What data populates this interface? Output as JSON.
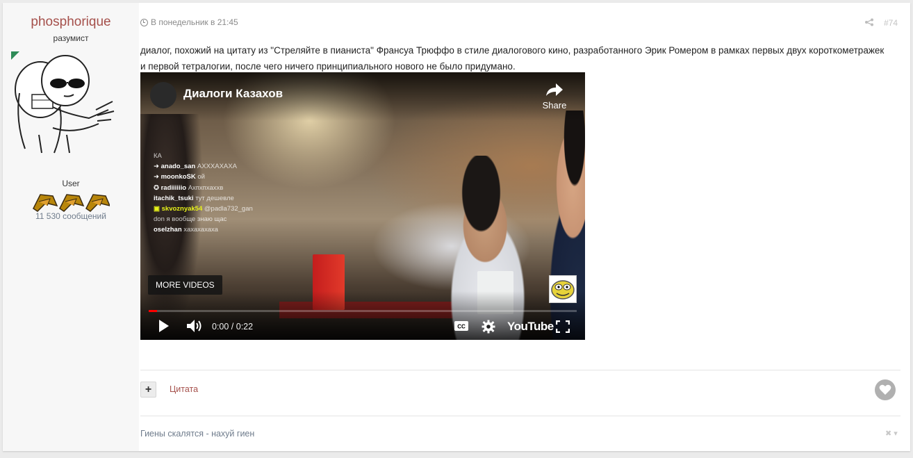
{
  "author": {
    "name": "phosphorique",
    "rank": "разумист",
    "group": "User",
    "posts": "11 530 сообщений"
  },
  "post": {
    "timestamp": "В понедельник в 21:45",
    "number": "#74",
    "text": "диалог, похожий на цитату из \"Стреляйте в пианиста\" Франсуа Трюффо в стиле диалогового кино, разработанного Эрик Ромером в рамках первых двух короткометражек и первой тетралогии, после чего ничего принципиального нового не было придумано."
  },
  "video": {
    "title": "Диалоги Казахов",
    "share_label": "Share",
    "more_videos_label": "MORE VIDEOS",
    "time": "0:00 / 0:22",
    "platform": "YouTube",
    "progress": 0.02,
    "chat": [
      {
        "user": "",
        "message": "КА"
      },
      {
        "user": "anado_san",
        "message": "АХХХАХАХА"
      },
      {
        "user": "moonkoSK",
        "message": "ой"
      },
      {
        "user": "radiiiiiio",
        "message": "Ахпхпхаххв"
      },
      {
        "user": "itachik_tsuki",
        "message": "тут дешевле"
      },
      {
        "user": "skvoznyak54",
        "message": "@padla732_gan"
      },
      {
        "user": "",
        "message": "don я вообще знаю щас"
      },
      {
        "user": "oselzhan",
        "message": "хахахахаха"
      }
    ]
  },
  "actions": {
    "plus_label": "+",
    "quote_label": "Цитата"
  },
  "signature": {
    "text": "Гиены скалятся - нахуй гиен",
    "close": "✖ ▾"
  },
  "icons": {
    "timestamp": "clock-icon",
    "share": "share-icon",
    "like": "heart-icon",
    "video_play": "play-icon",
    "video_volume": "volume-icon",
    "video_cc": "cc-icon",
    "video_settings": "gear-icon",
    "video_fullscreen": "fullscreen-icon"
  },
  "colors": {
    "accent": "#a5504b",
    "muted": "#8a8a8a",
    "progress": "#ff0000"
  }
}
